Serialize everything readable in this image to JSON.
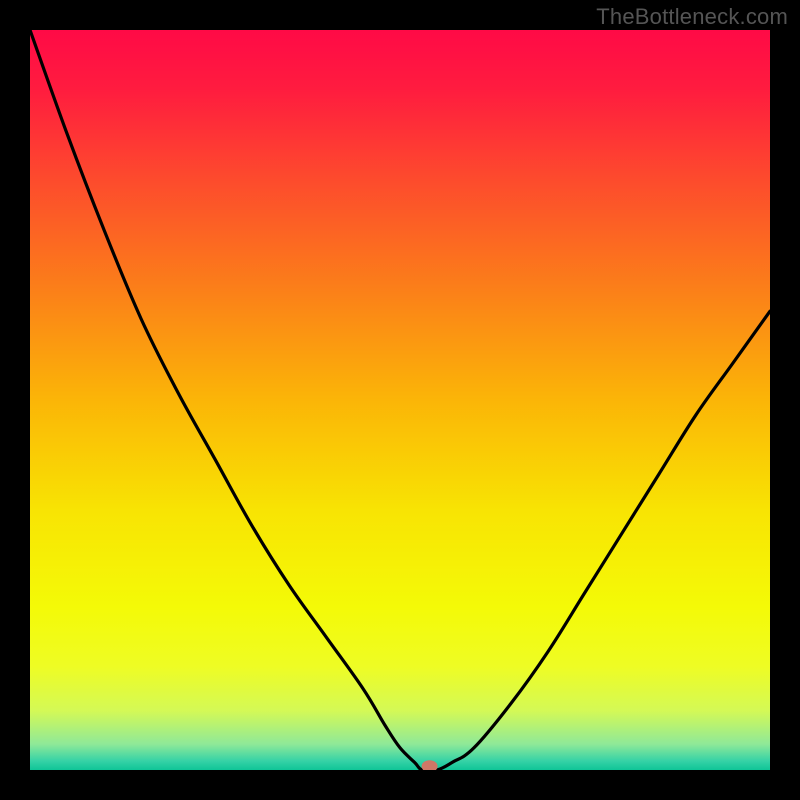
{
  "watermark": "TheBottleneck.com",
  "chart_data": {
    "type": "line",
    "title": "",
    "xlabel": "",
    "ylabel": "",
    "xlim": [
      0,
      100
    ],
    "ylim": [
      0,
      100
    ],
    "grid": false,
    "series": [
      {
        "name": "curve",
        "x": [
          0,
          5,
          10,
          15,
          20,
          25,
          30,
          35,
          40,
          45,
          48,
          50,
          52,
          53,
          55,
          57,
          60,
          65,
          70,
          75,
          80,
          85,
          90,
          95,
          100
        ],
        "values": [
          100,
          86,
          73,
          61,
          51,
          42,
          33,
          25,
          18,
          11,
          6,
          3,
          1,
          0,
          0,
          1,
          3,
          9,
          16,
          24,
          32,
          40,
          48,
          55,
          62
        ]
      }
    ],
    "marker": {
      "x": 54,
      "y": 0.5,
      "color": "#cf7766"
    },
    "background_gradient": {
      "stops": [
        {
          "pos": 0.0,
          "color": "#ff0a46"
        },
        {
          "pos": 0.08,
          "color": "#ff1c3f"
        },
        {
          "pos": 0.2,
          "color": "#fd4a2d"
        },
        {
          "pos": 0.35,
          "color": "#fb7f19"
        },
        {
          "pos": 0.5,
          "color": "#fbb507"
        },
        {
          "pos": 0.65,
          "color": "#f8e403"
        },
        {
          "pos": 0.78,
          "color": "#f4fa07"
        },
        {
          "pos": 0.86,
          "color": "#eefc24"
        },
        {
          "pos": 0.92,
          "color": "#d4f956"
        },
        {
          "pos": 0.965,
          "color": "#8fe998"
        },
        {
          "pos": 0.988,
          "color": "#35d2a6"
        },
        {
          "pos": 1.0,
          "color": "#0fc597"
        }
      ]
    }
  }
}
